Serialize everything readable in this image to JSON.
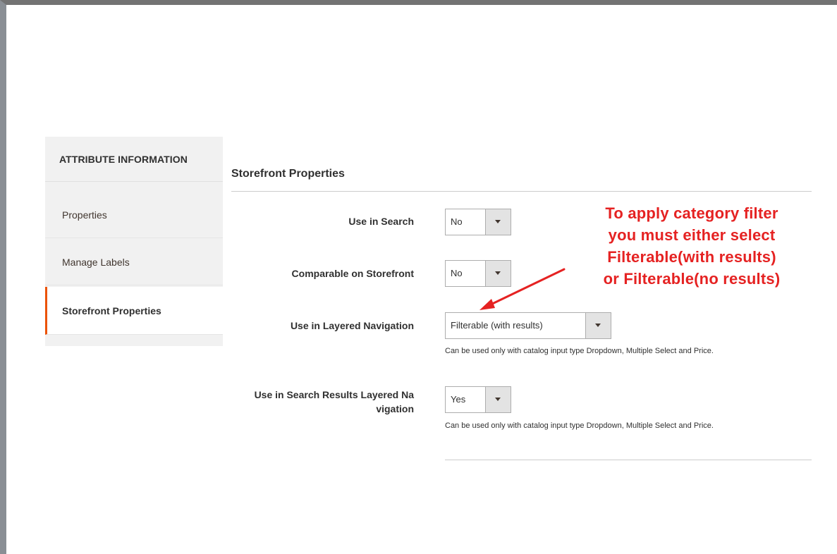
{
  "sidebar": {
    "title": "ATTRIBUTE INFORMATION",
    "items": [
      {
        "label": "Properties"
      },
      {
        "label": "Manage Labels"
      },
      {
        "label": "Storefront Properties",
        "active": true
      }
    ]
  },
  "section": {
    "title": "Storefront Properties"
  },
  "fields": {
    "use_in_search": {
      "label": "Use in Search",
      "value": "No"
    },
    "comparable": {
      "label": "Comparable on Storefront",
      "value": "No"
    },
    "layered_nav": {
      "label": "Use in Layered Navigation",
      "value": "Filterable (with results)",
      "note": "Can be used only with catalog input type Dropdown, Multiple Select and Price."
    },
    "search_layered_nav": {
      "label_line1": "Use in Search Results Layered Na",
      "label_line2": "vigation",
      "value": "Yes",
      "note": "Can be used only with catalog input type Dropdown, Multiple Select and Price."
    }
  },
  "annotation": {
    "lines": [
      "To apply category filter",
      "you must either select",
      "Filterable(with results)",
      "or Filterable(no results)"
    ],
    "color": "#e52222"
  },
  "colors": {
    "accent": "#eb5202"
  }
}
